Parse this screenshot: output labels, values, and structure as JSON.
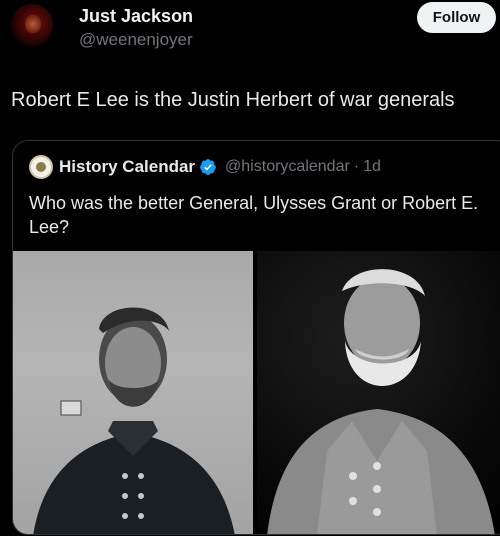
{
  "tweet": {
    "author_name": "Just Jackson",
    "author_handle": "@weenenjoyer",
    "follow_label": "Follow",
    "text": "Robert E Lee is the Justin Herbert of war generals"
  },
  "quote": {
    "author_name": "History Calendar",
    "author_handle": "@historycalendar",
    "separator": "·",
    "time": "1d",
    "text": "Who was the better General, Ulysses Grant or Robert E. Lee?",
    "verified_color": "#1d9bf0"
  }
}
